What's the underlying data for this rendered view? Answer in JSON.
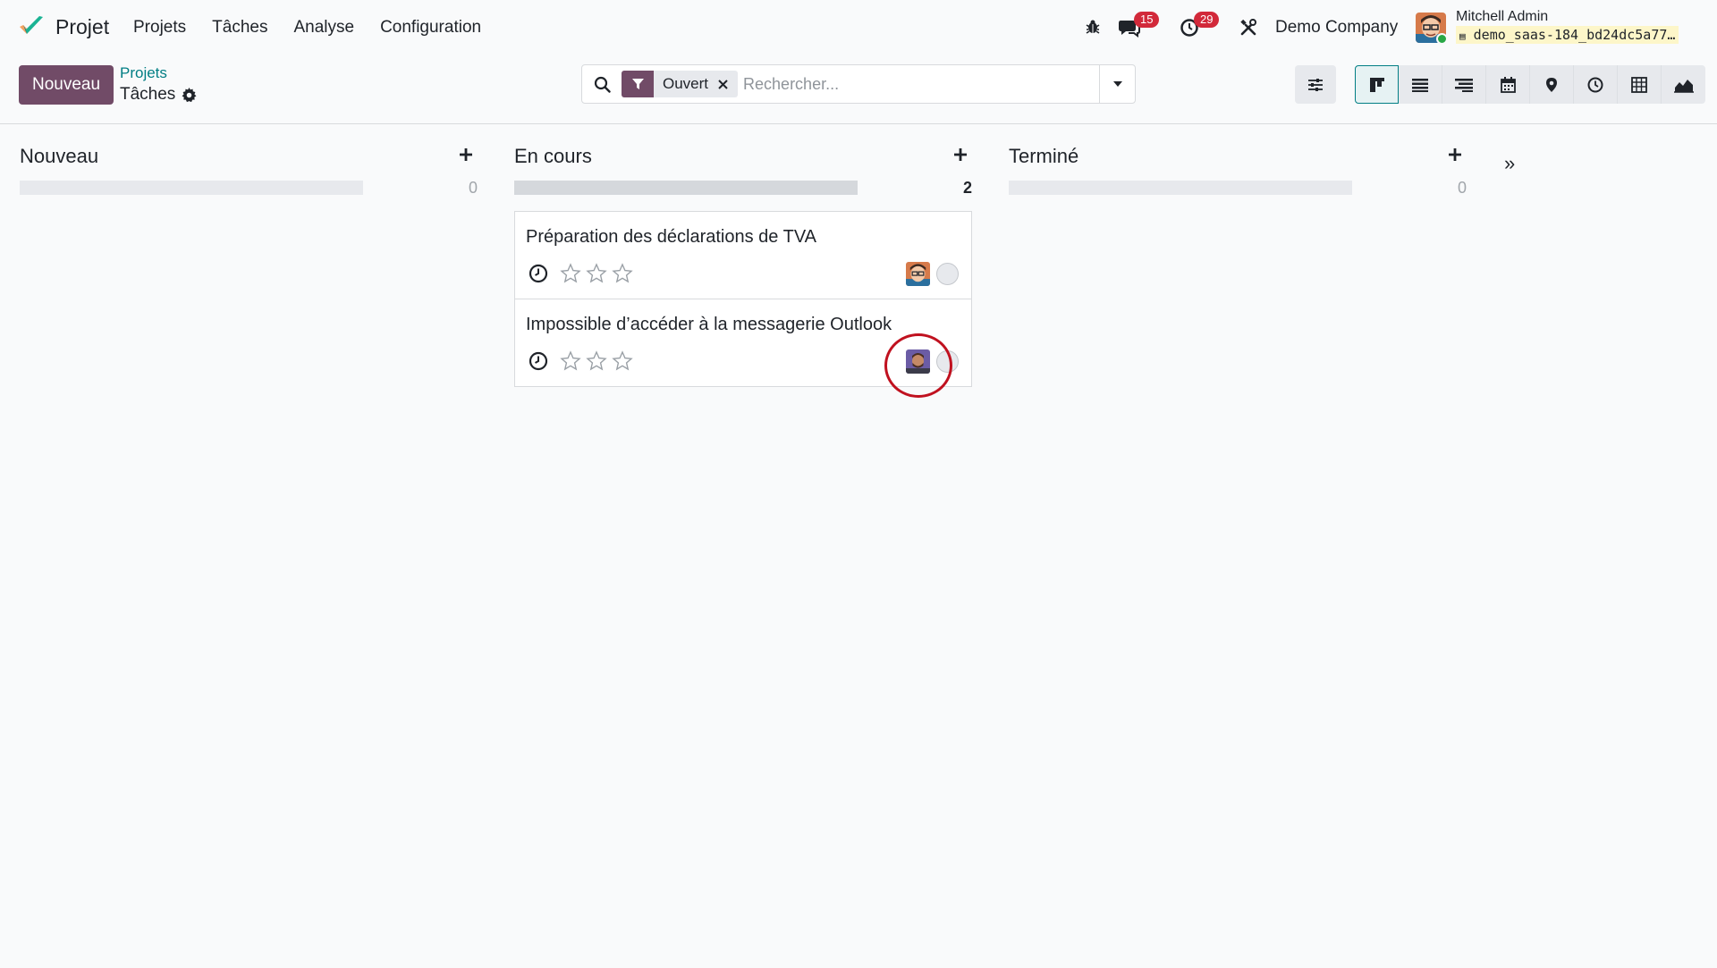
{
  "navbar": {
    "app_name": "Projet",
    "menu": [
      "Projets",
      "Tâches",
      "Analyse",
      "Configuration"
    ],
    "messages_count": "15",
    "activities_count": "29",
    "company": "Demo Company",
    "user_name": "Mitchell Admin",
    "database": "demo_saas-184_bd24dc5a77…"
  },
  "control_panel": {
    "new_button": "Nouveau",
    "breadcrumb_parent": "Projets",
    "breadcrumb_current": "Tâches",
    "search": {
      "facet_value": "Ouvert",
      "placeholder": "Rechercher..."
    },
    "views": [
      "kanban-icon",
      "list-icon",
      "gantt-icon",
      "calendar-icon",
      "map-icon",
      "activity-icon",
      "pivot-icon",
      "graph-icon"
    ]
  },
  "kanban": {
    "columns": [
      {
        "title": "Nouveau",
        "count": "0"
      },
      {
        "title": "En cours",
        "count": "2"
      },
      {
        "title": "Terminé",
        "count": "0"
      }
    ],
    "cards": [
      {
        "title": "Préparation des déclarations de TVA"
      },
      {
        "title": "Impossible d’accéder à la messagerie Outlook"
      }
    ]
  },
  "colors": {
    "brand": "#714b67",
    "link": "#017e84",
    "badge": "#d2293a",
    "annotation": "#c0111f"
  }
}
